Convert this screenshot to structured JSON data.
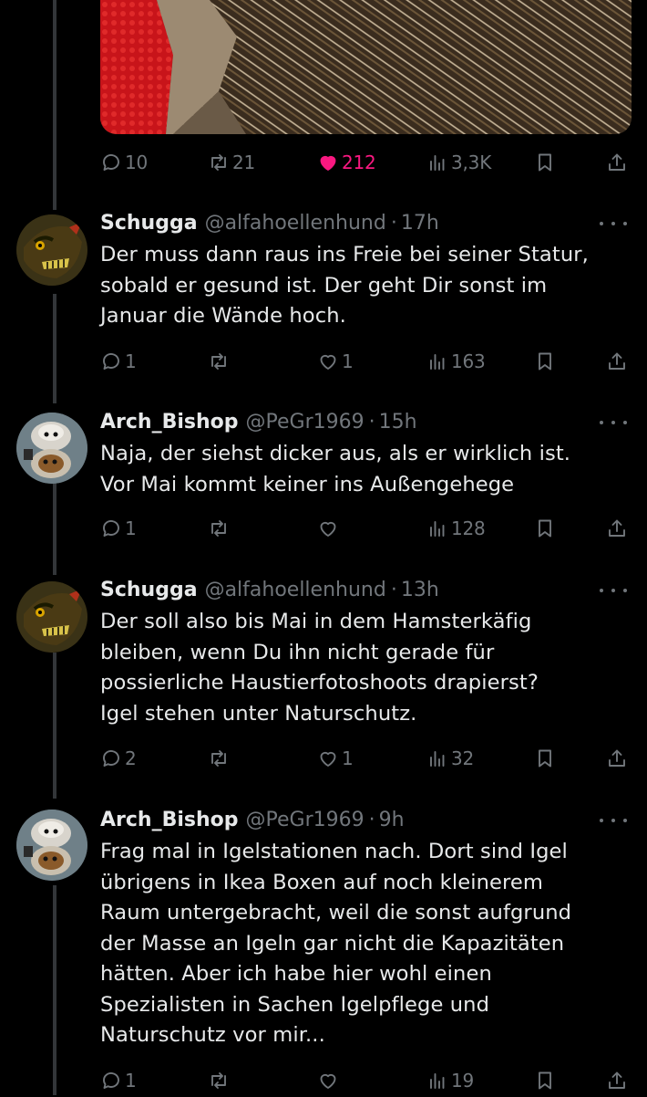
{
  "top_post": {
    "stats": {
      "replies": "10",
      "reposts": "21",
      "likes": "212",
      "views": "3,3K"
    }
  },
  "replies": [
    {
      "name": "Schugga",
      "handle": "@alfahoellenhund",
      "time": "17h",
      "text": "Der muss dann raus ins Freie bei seiner Statur,\nsobald er gesund ist. Der geht Dir sonst im\nJanuar die Wände hoch.",
      "replies": "1",
      "reposts": "",
      "likes": "1",
      "views": "163"
    },
    {
      "name": "Arch_Bishop",
      "handle": "@PeGr1969",
      "time": "15h",
      "text": "Naja, der siehst dicker aus, als er wirklich ist.\nVor Mai kommt keiner ins Außengehege",
      "replies": "1",
      "reposts": "",
      "likes": "",
      "views": "128"
    },
    {
      "name": "Schugga",
      "handle": "@alfahoellenhund",
      "time": "13h",
      "text": "Der soll also bis Mai in dem Hamsterkäfig\nbleiben, wenn Du ihn nicht gerade für\npossierliche Haustierfotoshoots drapierst?\nIgel stehen unter Naturschutz.",
      "replies": "2",
      "reposts": "",
      "likes": "1",
      "views": "32"
    },
    {
      "name": "Arch_Bishop",
      "handle": "@PeGr1969",
      "time": "9h",
      "text": "Frag mal in Igelstationen nach. Dort sind Igel\nübrigens in Ikea Boxen auf noch kleinerem\nRaum untergebracht, weil die sonst aufgrund\nder Masse an Igeln gar nicht die Kapazitäten\nhätten. Aber ich habe hier wohl einen\nSpezialisten in Sachen Igelpflege und\nNaturschutz vor mir...",
      "replies": "1",
      "reposts": "",
      "likes": "",
      "views": "19"
    }
  ],
  "sep": "·",
  "colors": {
    "background": "#000000",
    "text": "#e7e9ea",
    "muted": "#71767b",
    "like": "#f91880",
    "thread_line": "#333639"
  },
  "icons": {
    "reply": "speech-bubble-icon",
    "repost": "repost-arrows-icon",
    "like": "heart-icon",
    "views": "bar-chart-icon",
    "bookmark": "bookmark-icon",
    "share": "share-upload-icon",
    "more": "ellipsis-icon"
  }
}
